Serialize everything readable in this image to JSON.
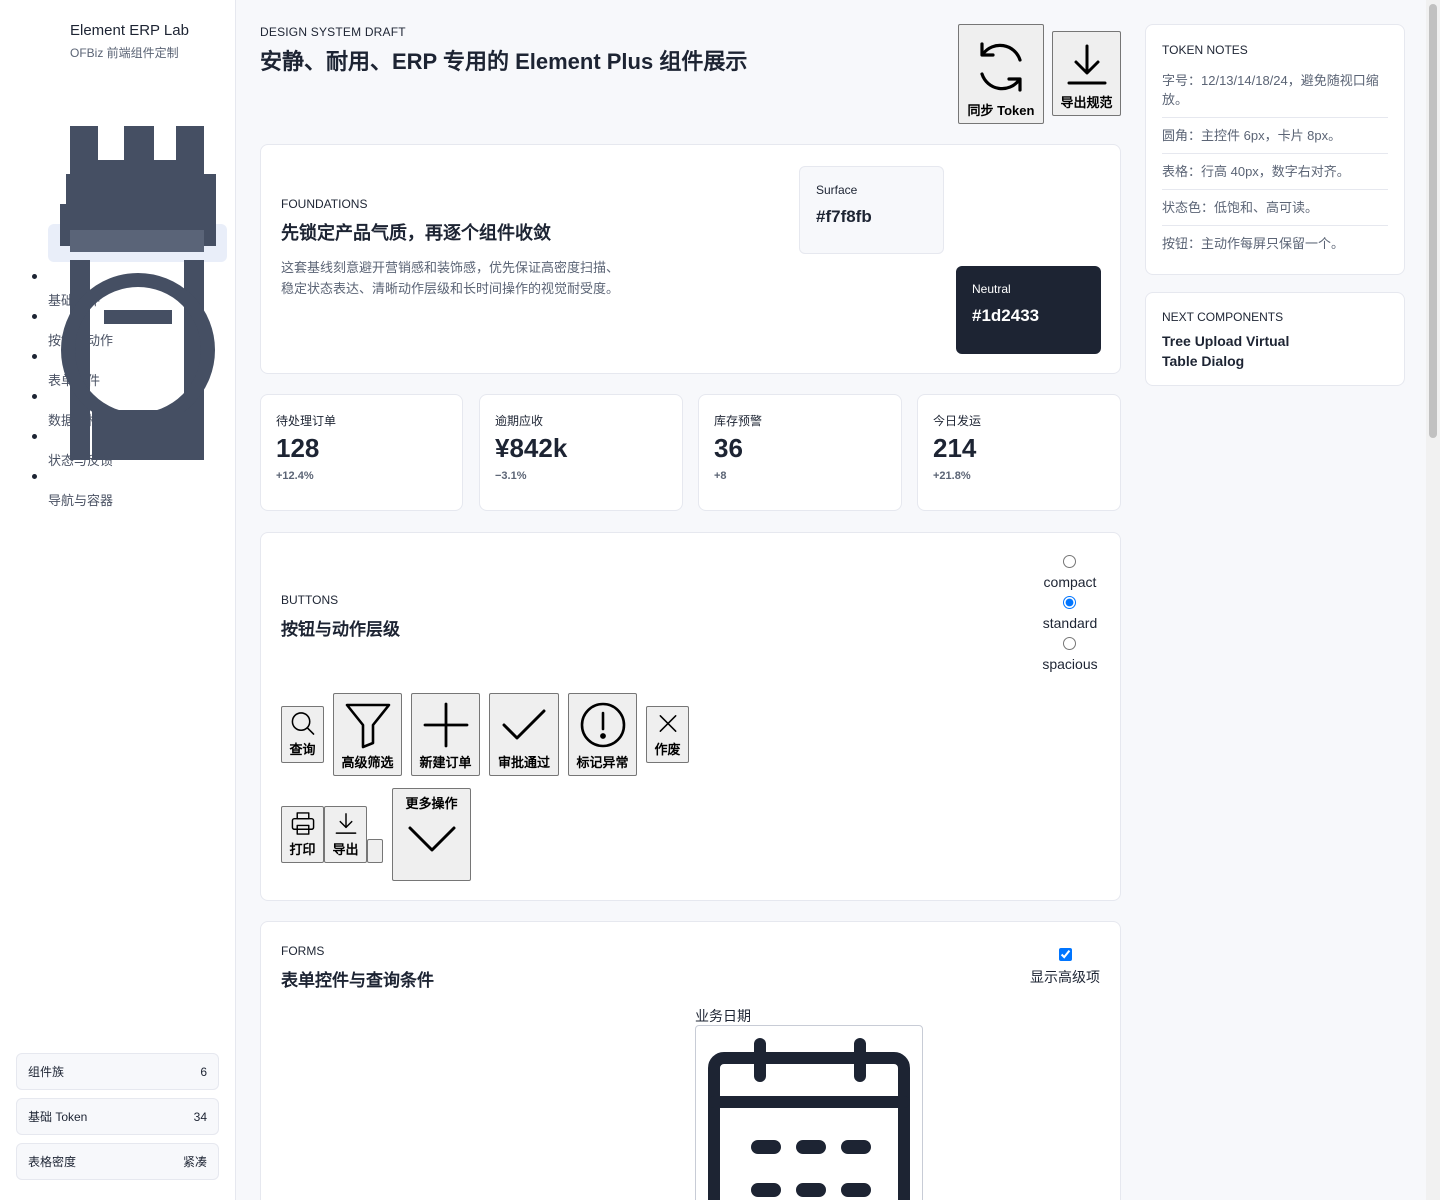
{
  "sidebar": {
    "brand_title": "Element ERP Lab",
    "brand_subtitle": "OFBiz 前端组件定制",
    "nav_items": [
      {
        "label": "基础组件"
      },
      {
        "label": "按钮与动作"
      },
      {
        "label": "表单控件"
      },
      {
        "label": "数据表格"
      },
      {
        "label": "状态与反馈"
      },
      {
        "label": "导航与容器"
      }
    ],
    "stats": [
      {
        "label": "组件族",
        "value": "6"
      },
      {
        "label": "基础 Token",
        "value": "34"
      },
      {
        "label": "表格密度",
        "value": "紧凑"
      }
    ]
  },
  "header": {
    "eyebrow": "DESIGN SYSTEM DRAFT",
    "title": "安静、耐用、ERP 专用的 Element Plus 组件展示",
    "sync_label": "同步 Token",
    "export_label": "导出规范"
  },
  "foundations": {
    "eyebrow": "FOUNDATIONS",
    "title": "先锁定产品气质，再逐个组件收敛",
    "description": "这套基线刻意避开营销感和装饰感，优先保证高密度扫描、稳定状态表达、清晰动作层级和长时间操作的视觉耐受度。",
    "swatches": [
      {
        "name": "Surface",
        "value": "#f7f8fb"
      },
      {
        "name": "Neutral",
        "value": "#1d2433"
      }
    ]
  },
  "kpis": [
    {
      "label": "待处理订单",
      "value": "128",
      "delta": "+12.4%"
    },
    {
      "label": "逾期应收",
      "value": "¥842k",
      "delta": "−3.1%"
    },
    {
      "label": "库存预警",
      "value": "36",
      "delta": "+8"
    },
    {
      "label": "今日发运",
      "value": "214",
      "delta": "+21.8%"
    }
  ],
  "buttons": {
    "eyebrow": "BUTTONS",
    "title": "按钮与动作层级",
    "density_options": [
      {
        "label": "compact",
        "checked": false
      },
      {
        "label": "standard",
        "checked": true
      },
      {
        "label": "spacious",
        "checked": false
      }
    ],
    "row1": [
      {
        "label": "查询",
        "icon": "search-icon"
      },
      {
        "label": "高级筛选",
        "icon": "filter-icon"
      },
      {
        "label": "新建订单",
        "icon": "plus-icon"
      },
      {
        "label": "审批通过",
        "icon": "check-icon"
      },
      {
        "label": "标记异常",
        "icon": "warning-icon"
      },
      {
        "label": "作废",
        "icon": "close-icon"
      }
    ],
    "row2": [
      {
        "label": "打印",
        "icon": "printer-icon"
      },
      {
        "label": "导出",
        "icon": "download-icon"
      },
      {
        "label": "更多操作",
        "icon": "chevron-down-icon"
      }
    ]
  },
  "forms": {
    "eyebrow": "FORMS",
    "title": "表单控件与查询条件",
    "advanced_label": "显示高级项",
    "advanced_checked": true,
    "date_label": "业务日期"
  },
  "token_notes": {
    "title": "TOKEN NOTES",
    "items": [
      "字号：12/13/14/18/24，避免随视口缩放。",
      "圆角：主控件 6px，卡片 8px。",
      "表格：行高 40px，数字右对齐。",
      "状态色：低饱和、高可读。",
      "按钮：主动作每屏只保留一个。"
    ]
  },
  "next_components": {
    "title": "NEXT COMPONENTS",
    "items": "Tree Upload Virtual Table Dialog"
  },
  "colors": {
    "neutral": "#1d2433",
    "surface": "#f7f8fb",
    "accent": "#0a63d9"
  }
}
